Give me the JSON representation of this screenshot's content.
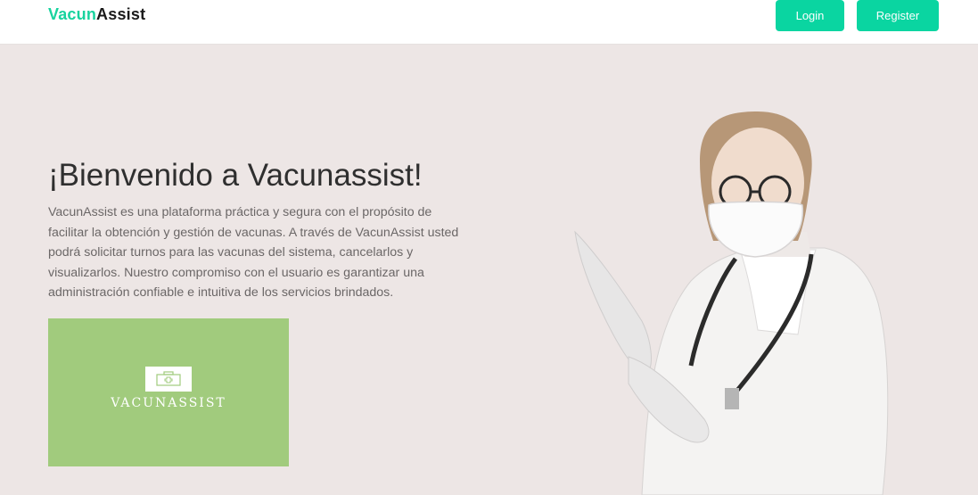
{
  "header": {
    "brand_part1": "Vacun",
    "brand_part2": "Assist",
    "login_label": "Login",
    "register_label": "Register"
  },
  "hero": {
    "title": "¡Bienvenido a Vacunassist!",
    "description": "VacunAssist es una plataforma práctica y segura con el propósito de facilitar la obtención y gestión de vacunas. A través de VacunAssist usted podrá solicitar turnos para las vacunas del sistema, cancelarlos y visualizarlos. Nuestro compromiso con el usuario es garantizar una administración confiable e intuitiva de los servicios brindados.",
    "logo_text": "VACUNASSIST",
    "logo_icon": "medical-kit-icon",
    "image": "doctor-with-mask-and-stethoscope"
  },
  "colors": {
    "accent": "#0ad5a1",
    "brand_green": "#17d39e",
    "background": "#ede6e5",
    "logo_card": "#a1cb7d"
  }
}
